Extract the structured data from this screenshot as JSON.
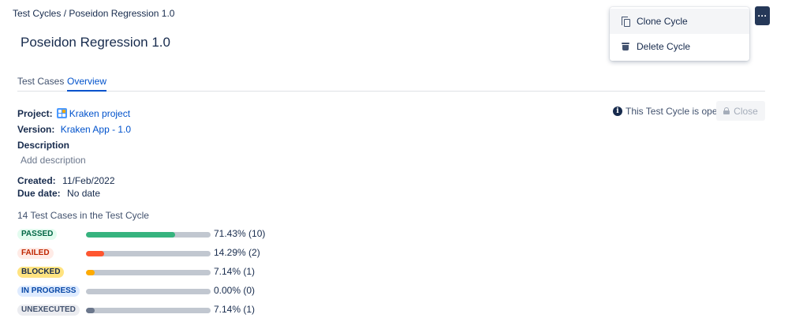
{
  "breadcrumb": {
    "parent": "Test Cycles",
    "separator": " / ",
    "current": "Poseidon Regression 1.0"
  },
  "page_title": "Poseidon Regression 1.0",
  "tabs": [
    {
      "label": "Test Cases",
      "active": false
    },
    {
      "label": "Overview",
      "active": true
    }
  ],
  "project": {
    "label": "Project:",
    "value": "Kraken project",
    "icon": "project-icon"
  },
  "version": {
    "label": "Version:",
    "value": "Kraken App - 1.0"
  },
  "description": {
    "label": "Description",
    "placeholder": "Add description"
  },
  "created": {
    "label": "Created:",
    "value": "11/Feb/2022"
  },
  "due_date": {
    "label": "Due date:",
    "value": "No date"
  },
  "summary": "14 Test Cases in the Test Cycle",
  "statuses": [
    {
      "label": "PASSED",
      "text": "71.43% (10)",
      "fraction": 0.7143,
      "bar_color": "#36b37e",
      "lozenge_bg": "#e3fcef",
      "lozenge_fg": "#006644"
    },
    {
      "label": "FAILED",
      "text": "14.29% (2)",
      "fraction": 0.1429,
      "bar_color": "#ff5630",
      "lozenge_bg": "#ffebe6",
      "lozenge_fg": "#bf2600"
    },
    {
      "label": "BLOCKED",
      "text": "7.14% (1)",
      "fraction": 0.0714,
      "bar_color": "#ffab00",
      "lozenge_bg": "#ffe380",
      "lozenge_fg": "#172b4d"
    },
    {
      "label": "IN PROGRESS",
      "text": "0.00% (0)",
      "fraction": 0.0,
      "bar_color": "#0065ff",
      "lozenge_bg": "#deebff",
      "lozenge_fg": "#0747a6"
    },
    {
      "label": "UNEXECUTED",
      "text": "7.14% (1)",
      "fraction": 0.0714,
      "bar_color": "#6b778c",
      "lozenge_bg": "#ebecf0",
      "lozenge_fg": "#42526e"
    }
  ],
  "cycle_status": {
    "text": "This Test Cycle is open",
    "icon": "info-icon"
  },
  "close_button": {
    "label": "Close",
    "icon": "lock-icon",
    "disabled": true
  },
  "more_button": {
    "label": "···",
    "icon": "more-icon"
  },
  "menu": {
    "items": [
      {
        "label": "Clone Cycle",
        "icon": "copy-icon"
      },
      {
        "label": "Delete Cycle",
        "icon": "trash-icon"
      }
    ]
  }
}
